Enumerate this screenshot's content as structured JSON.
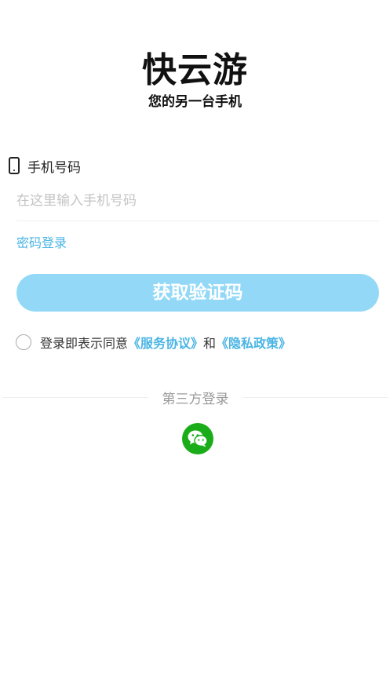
{
  "app": {
    "title": "快云游",
    "subtitle": "您的另一台手机"
  },
  "form": {
    "phone_label": "手机号码",
    "phone_placeholder": "在这里输入手机号码",
    "phone_value": "",
    "password_login": "密码登录",
    "get_code_label": "获取验证码"
  },
  "agreement": {
    "prefix": "登录即表示同意",
    "service_link": "《服务协议》",
    "and": "和",
    "privacy_link": "《隐私政策》",
    "checked": false
  },
  "third_party": {
    "label": "第三方登录",
    "wechat_icon": "wechat-icon"
  },
  "colors": {
    "accent": "#4ab5e4",
    "button": "#93d9f7",
    "wechat": "#1aad19"
  }
}
